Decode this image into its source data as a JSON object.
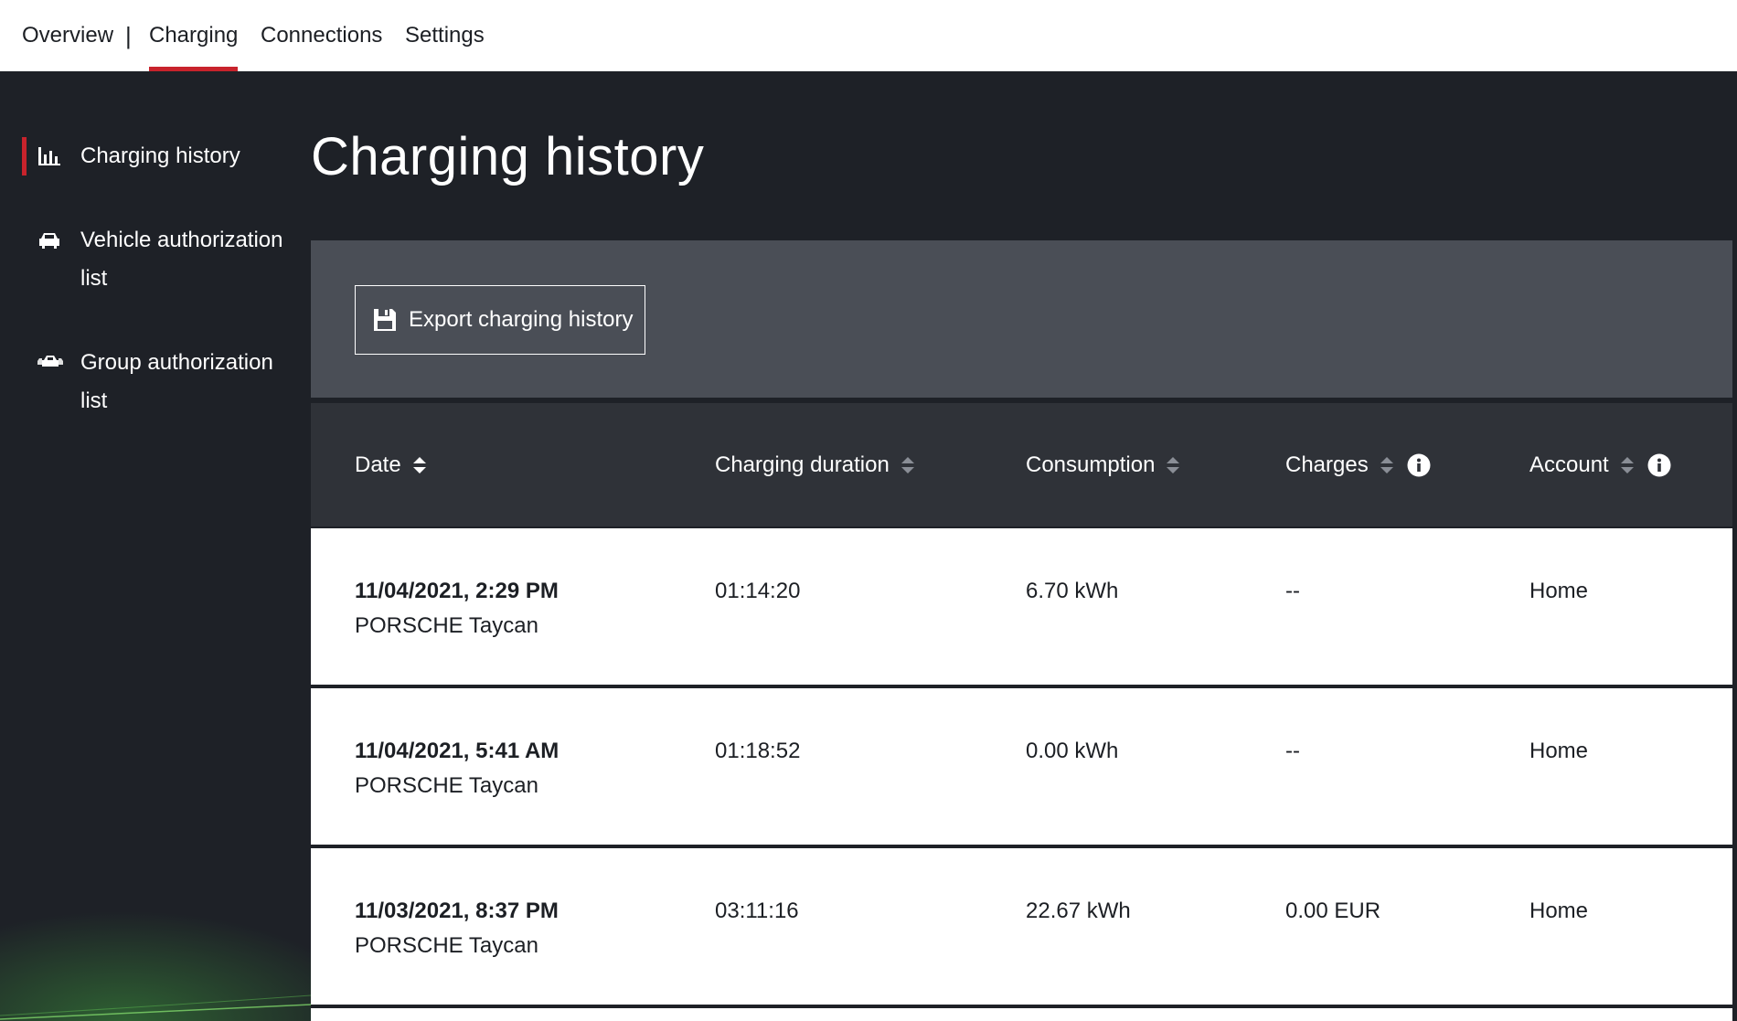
{
  "nav": {
    "tabs": [
      {
        "label": "Overview"
      },
      {
        "label": "Charging"
      },
      {
        "label": "Connections"
      },
      {
        "label": "Settings"
      }
    ],
    "separator": "|",
    "active": "Charging"
  },
  "sidebar": {
    "items": [
      {
        "label": "Charging history",
        "icon": "bar-chart-icon",
        "active": true
      },
      {
        "label": "Vehicle authorization list",
        "icon": "car-icon",
        "active": false
      },
      {
        "label": "Group authorization list",
        "icon": "car-group-icon",
        "active": false
      }
    ]
  },
  "page": {
    "title": "Charging history"
  },
  "toolbar": {
    "export_label": "Export charging history",
    "export_icon": "save-icon"
  },
  "table": {
    "columns": [
      {
        "label": "Date",
        "sort": "active"
      },
      {
        "label": "Charging duration",
        "sort": "none"
      },
      {
        "label": "Consumption",
        "sort": "none"
      },
      {
        "label": "Charges",
        "sort": "none",
        "info": true
      },
      {
        "label": "Account",
        "sort": "none",
        "info": true
      }
    ],
    "rows": [
      {
        "date": "11/04/2021, 2:29 PM",
        "vehicle": "PORSCHE Taycan",
        "duration": "01:14:20",
        "consumption": "6.70 kWh",
        "charges": "--",
        "account": "Home"
      },
      {
        "date": "11/04/2021, 5:41 AM",
        "vehicle": "PORSCHE Taycan",
        "duration": "01:18:52",
        "consumption": "0.00 kWh",
        "charges": "--",
        "account": "Home"
      },
      {
        "date": "11/03/2021, 8:37 PM",
        "vehicle": "PORSCHE Taycan",
        "duration": "03:11:16",
        "consumption": "22.67 kWh",
        "charges": "0.00 EUR",
        "account": "Home"
      }
    ]
  },
  "colors": {
    "accent": "#c8232c",
    "background": "#1e2127",
    "toolbar": "#4a4e56",
    "table_header": "#2f3238"
  }
}
